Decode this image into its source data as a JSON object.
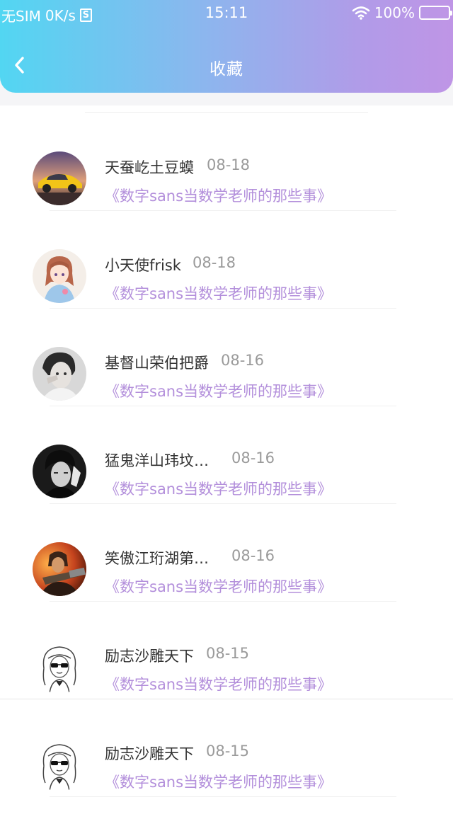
{
  "status_bar": {
    "carrier": "无SIM",
    "speed": "0K/s",
    "box_glyph": "S",
    "time": "15:11",
    "battery_pct": "100%",
    "battery_color": "#f7c21b"
  },
  "header": {
    "title": "收藏",
    "back_icon": "chevron-left-icon",
    "gradient": [
      "#52d6f2",
      "#bf95e6"
    ]
  },
  "favorites": [
    {
      "user": "天蚕屹土豆蟆",
      "date": "08-18",
      "post": "《数字sans当数学老师的那些事》",
      "avatar": "car-avatar"
    },
    {
      "user": "小天使frisk",
      "date": "08-18",
      "post": "《数字sans当数学老师的那些事》",
      "avatar": "anime-girl-avatar"
    },
    {
      "user": "基督山荣伯把爵",
      "date": "08-16",
      "post": "《数字sans当数学老师的那些事》",
      "avatar": "bw-portrait-avatar"
    },
    {
      "user": "猛鬼洋山玮坟…",
      "date": "08-16",
      "post": "《数字sans当数学老师的那些事》",
      "avatar": "bw-man-avatar"
    },
    {
      "user": "笑傲江珩湖第…",
      "date": "08-16",
      "post": "《数字sans当数学老师的那些事》",
      "avatar": "game-warrior-avatar"
    },
    {
      "user": "励志沙雕天下",
      "date": "08-15",
      "post": "《数字sans当数学老师的那些事》",
      "avatar": "sketch-sunglasses-avatar"
    },
    {
      "user": "励志沙雕天下",
      "date": "08-15",
      "post": "《数字sans当数学老师的那些事》",
      "avatar": "sketch-sunglasses-avatar"
    }
  ],
  "accent_colors": {
    "post_link": "#b38fdb",
    "date": "#9a9a9a",
    "name": "#333333"
  }
}
